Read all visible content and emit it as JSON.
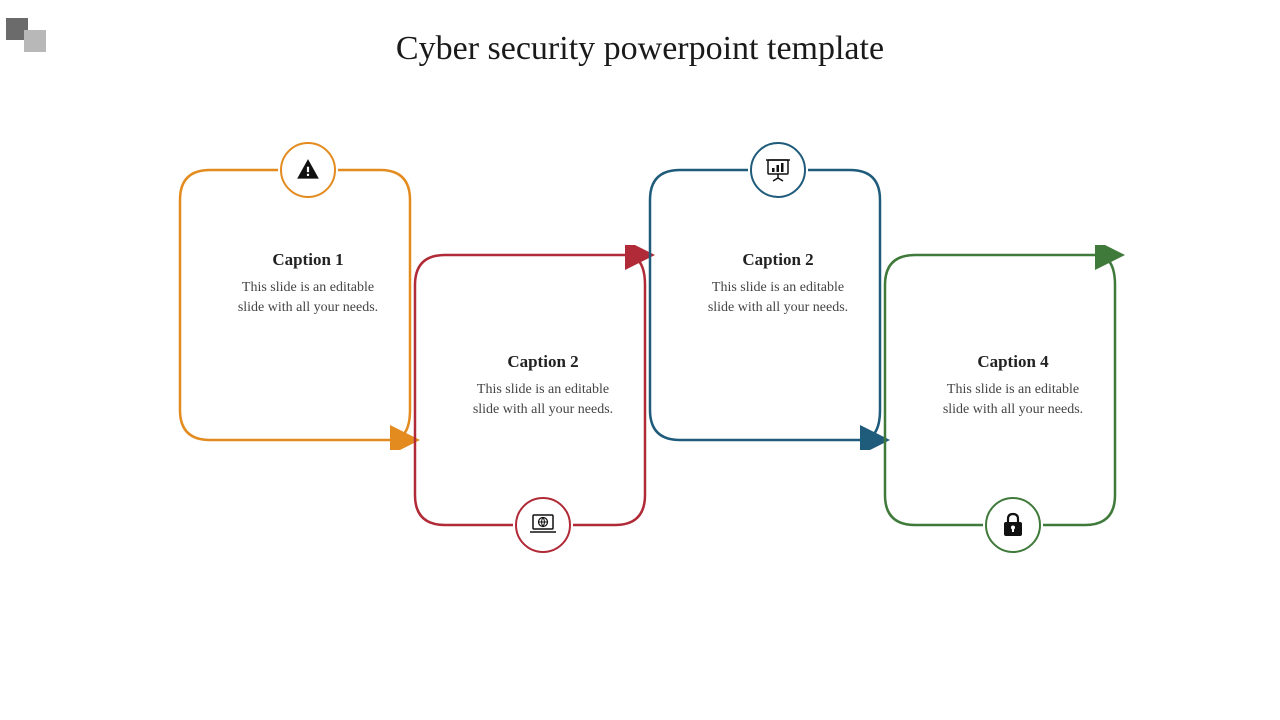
{
  "title": "Cyber security powerpoint template",
  "colors": {
    "orange": "#e38b1f",
    "red": "#b02a37",
    "blue": "#1f5b7a",
    "green": "#3f7a3a"
  },
  "cards": [
    {
      "id": "card1",
      "caption": "Caption 1",
      "body": "This slide is an editable slide with all your needs.",
      "icon": "warning-icon"
    },
    {
      "id": "card2",
      "caption": "Caption 2",
      "body": "This slide is an editable slide with all your needs.",
      "icon": "laptop-globe-icon"
    },
    {
      "id": "card3",
      "caption": "Caption 2",
      "body": "This slide is an editable slide with all your needs.",
      "icon": "presentation-chart-icon"
    },
    {
      "id": "card4",
      "caption": "Caption 4",
      "body": "This slide is an editable slide with all your needs.",
      "icon": "lock-icon"
    }
  ]
}
